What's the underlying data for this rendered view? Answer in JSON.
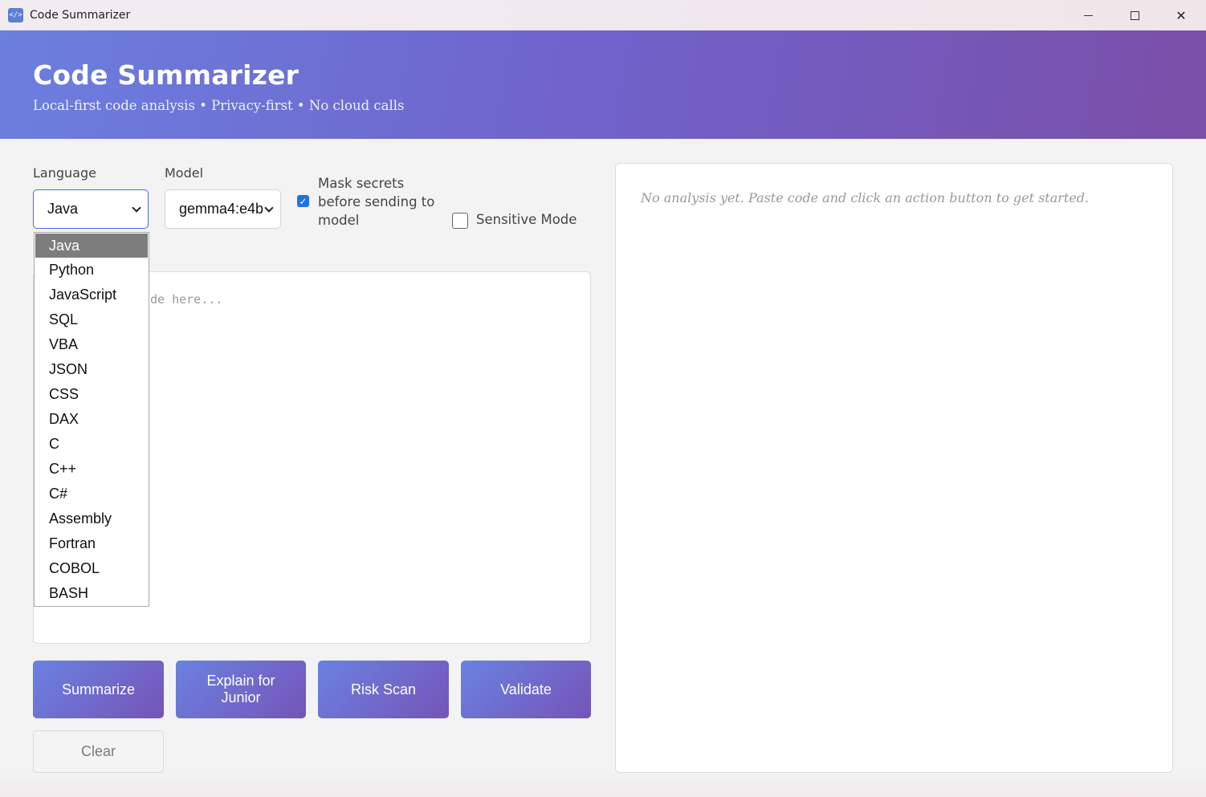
{
  "window": {
    "icon_glyph": "</>",
    "title": "Code Summarizer",
    "minimize": "minimize",
    "maximize": "maximize",
    "close": "✕"
  },
  "header": {
    "title": "Code Summarizer",
    "subtitle": "Local-first code analysis • Privacy-first • No cloud calls"
  },
  "controls": {
    "language_label": "Language",
    "language_value": "Java",
    "model_label": "Model",
    "model_value": "gemma4:e4b",
    "mask_secrets_label": "Mask secrets before sending to model",
    "mask_secrets_checked": true,
    "sensitive_mode_label": "Sensitive Mode",
    "sensitive_mode_checked": false
  },
  "language_options": [
    "Java",
    "Python",
    "JavaScript",
    "SQL",
    "VBA",
    "JSON",
    "CSS",
    "DAX",
    "C",
    "C++",
    "C#",
    "Assembly",
    "Fortran",
    "COBOL",
    "BASH"
  ],
  "editor": {
    "placeholder": "Paste your code here...",
    "visible_placeholder_fragment": "de here..."
  },
  "actions": {
    "summarize": "Summarize",
    "explain": "Explain for Junior",
    "risk_scan": "Risk Scan",
    "validate": "Validate",
    "clear": "Clear"
  },
  "output": {
    "empty_message": "No analysis yet. Paste code and click an action button to get started."
  },
  "colors": {
    "accent_start": "#6a82e0",
    "accent_end": "#7554b8",
    "checkbox_blue": "#1a73e8"
  }
}
